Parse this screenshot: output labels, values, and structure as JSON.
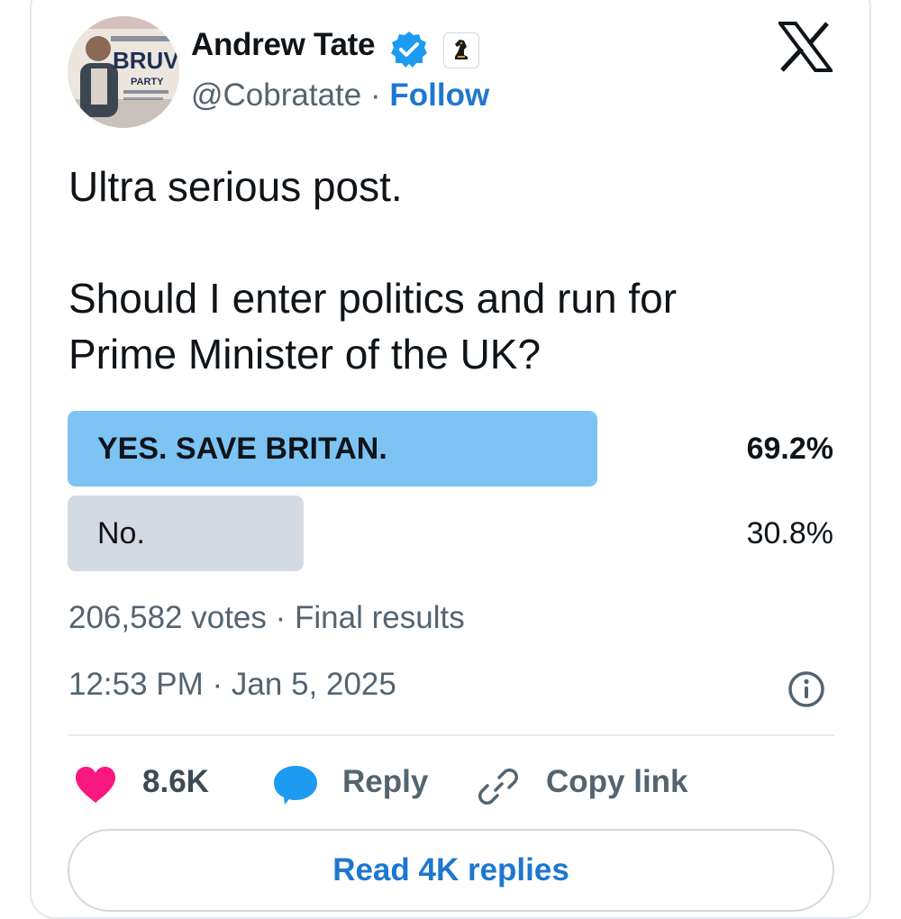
{
  "author": {
    "name": "Andrew Tate",
    "handle": "@Cobratate",
    "separator": " · ",
    "follow_label": "Follow",
    "avatar_logo_text": "BRUV",
    "avatar_logo_sub": "PARTY"
  },
  "post": {
    "line1": "Ultra serious post.",
    "line2": "Should I enter politics and run for",
    "line3": "Prime Minister of the UK?"
  },
  "poll": {
    "options": [
      {
        "label": "YES. SAVE BRITAN.",
        "percent_text": "69.2%",
        "percent": 69.2,
        "winner": true
      },
      {
        "label": "No.",
        "percent_text": "30.8%",
        "percent": 30.8,
        "winner": false
      }
    ],
    "votes": "206,582 votes",
    "status": "Final results"
  },
  "timestamp": {
    "time": "12:53 PM",
    "date": "Jan 5, 2025"
  },
  "actions": {
    "likes": "8.6K",
    "reply_label": "Reply",
    "copy_link_label": "Copy link"
  },
  "read_replies_label": "Read 4K replies",
  "icons": {
    "verified": "verified-badge-icon",
    "affiliate": "chess-knight-badge-icon",
    "platform": "x-logo-icon",
    "info": "info-icon",
    "like": "heart-icon",
    "reply": "speech-bubble-icon",
    "copy": "link-icon"
  },
  "colors": {
    "accent": "#1d77d1",
    "verified": "#1d9bf0",
    "winner_bar": "#7dc3f4",
    "other_bar": "#d3dae1",
    "heart": "#f91880",
    "reply_bubble": "#1d9bf0",
    "muted_text": "#536471"
  }
}
